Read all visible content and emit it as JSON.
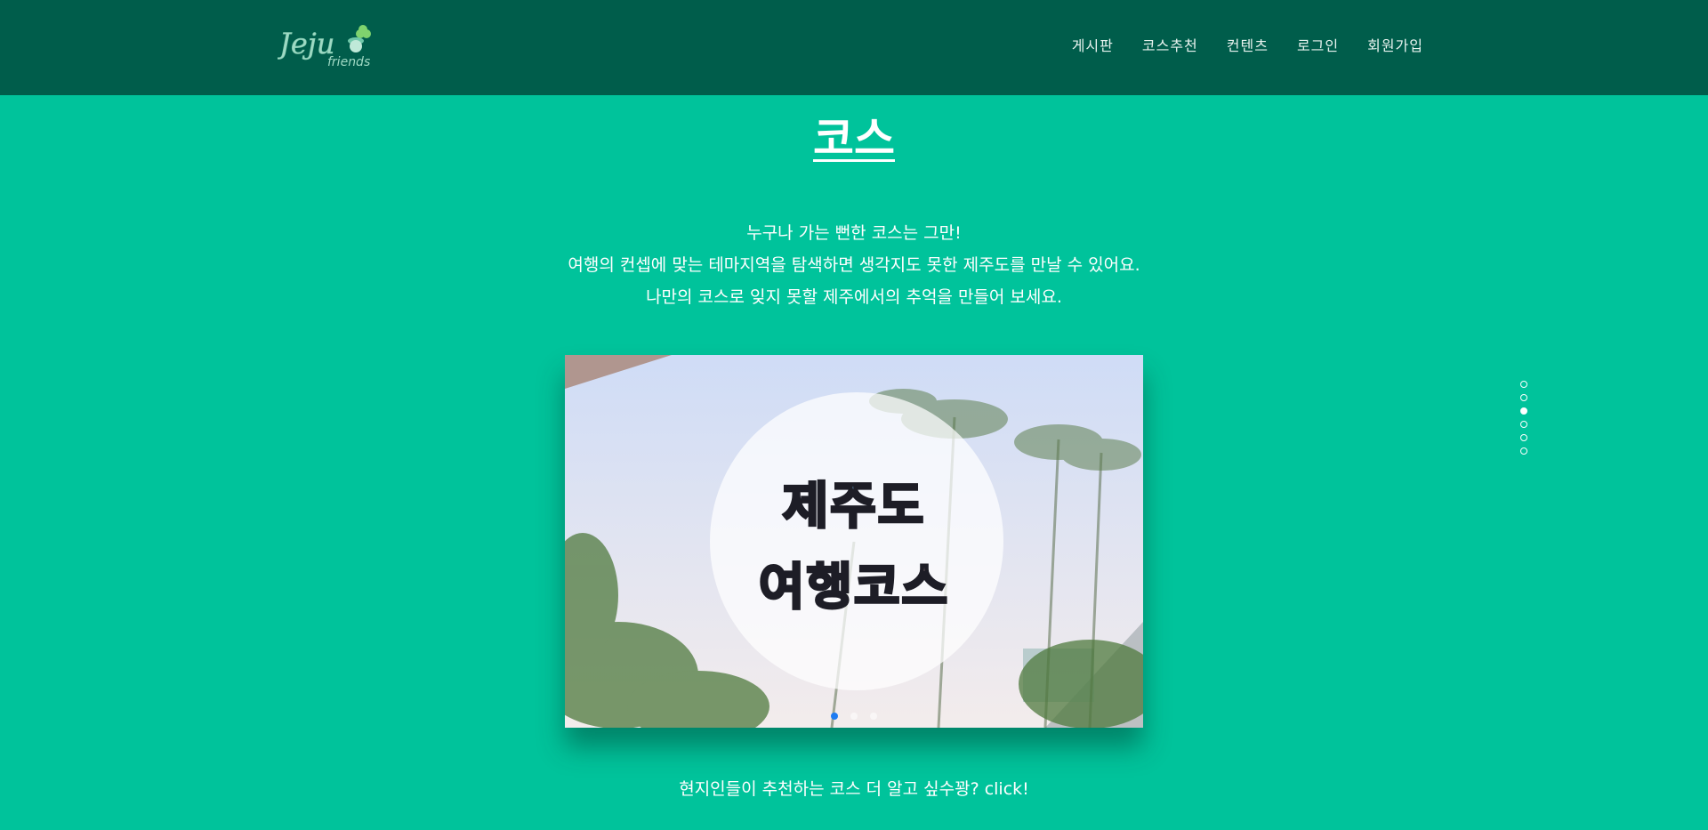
{
  "header": {
    "logo_text": "Jeju",
    "logo_subtext": "friends",
    "nav": [
      {
        "label": "게시판"
      },
      {
        "label": "코스추천"
      },
      {
        "label": "컨텐츠"
      },
      {
        "label": "로그인"
      },
      {
        "label": "회원가입"
      }
    ]
  },
  "section": {
    "title": "코스",
    "intro_lines": [
      "누구나 가는 뻔한 코스는 그만!",
      "여행의 컨셉에 맞는 테마지역을 탐색하면 생각지도 못한 제주도를 만날 수 있어요.",
      "나만의 코스로 잊지 못할 제주에서의 추억을 만들어 보세요."
    ]
  },
  "slider": {
    "line1": "제주도",
    "line2": "여행코스",
    "slide_count": 3,
    "active_slide": 1
  },
  "page_nav": {
    "count": 6,
    "active": 3
  },
  "cta": {
    "label": "현지인들이 추천하는 코스 더 알고 싶수꽝? click!"
  },
  "colors": {
    "background": "#00c39b",
    "header": "#005d4b",
    "accent_blue": "#7ec1ee",
    "accent_pink": "#f7c2c8"
  }
}
